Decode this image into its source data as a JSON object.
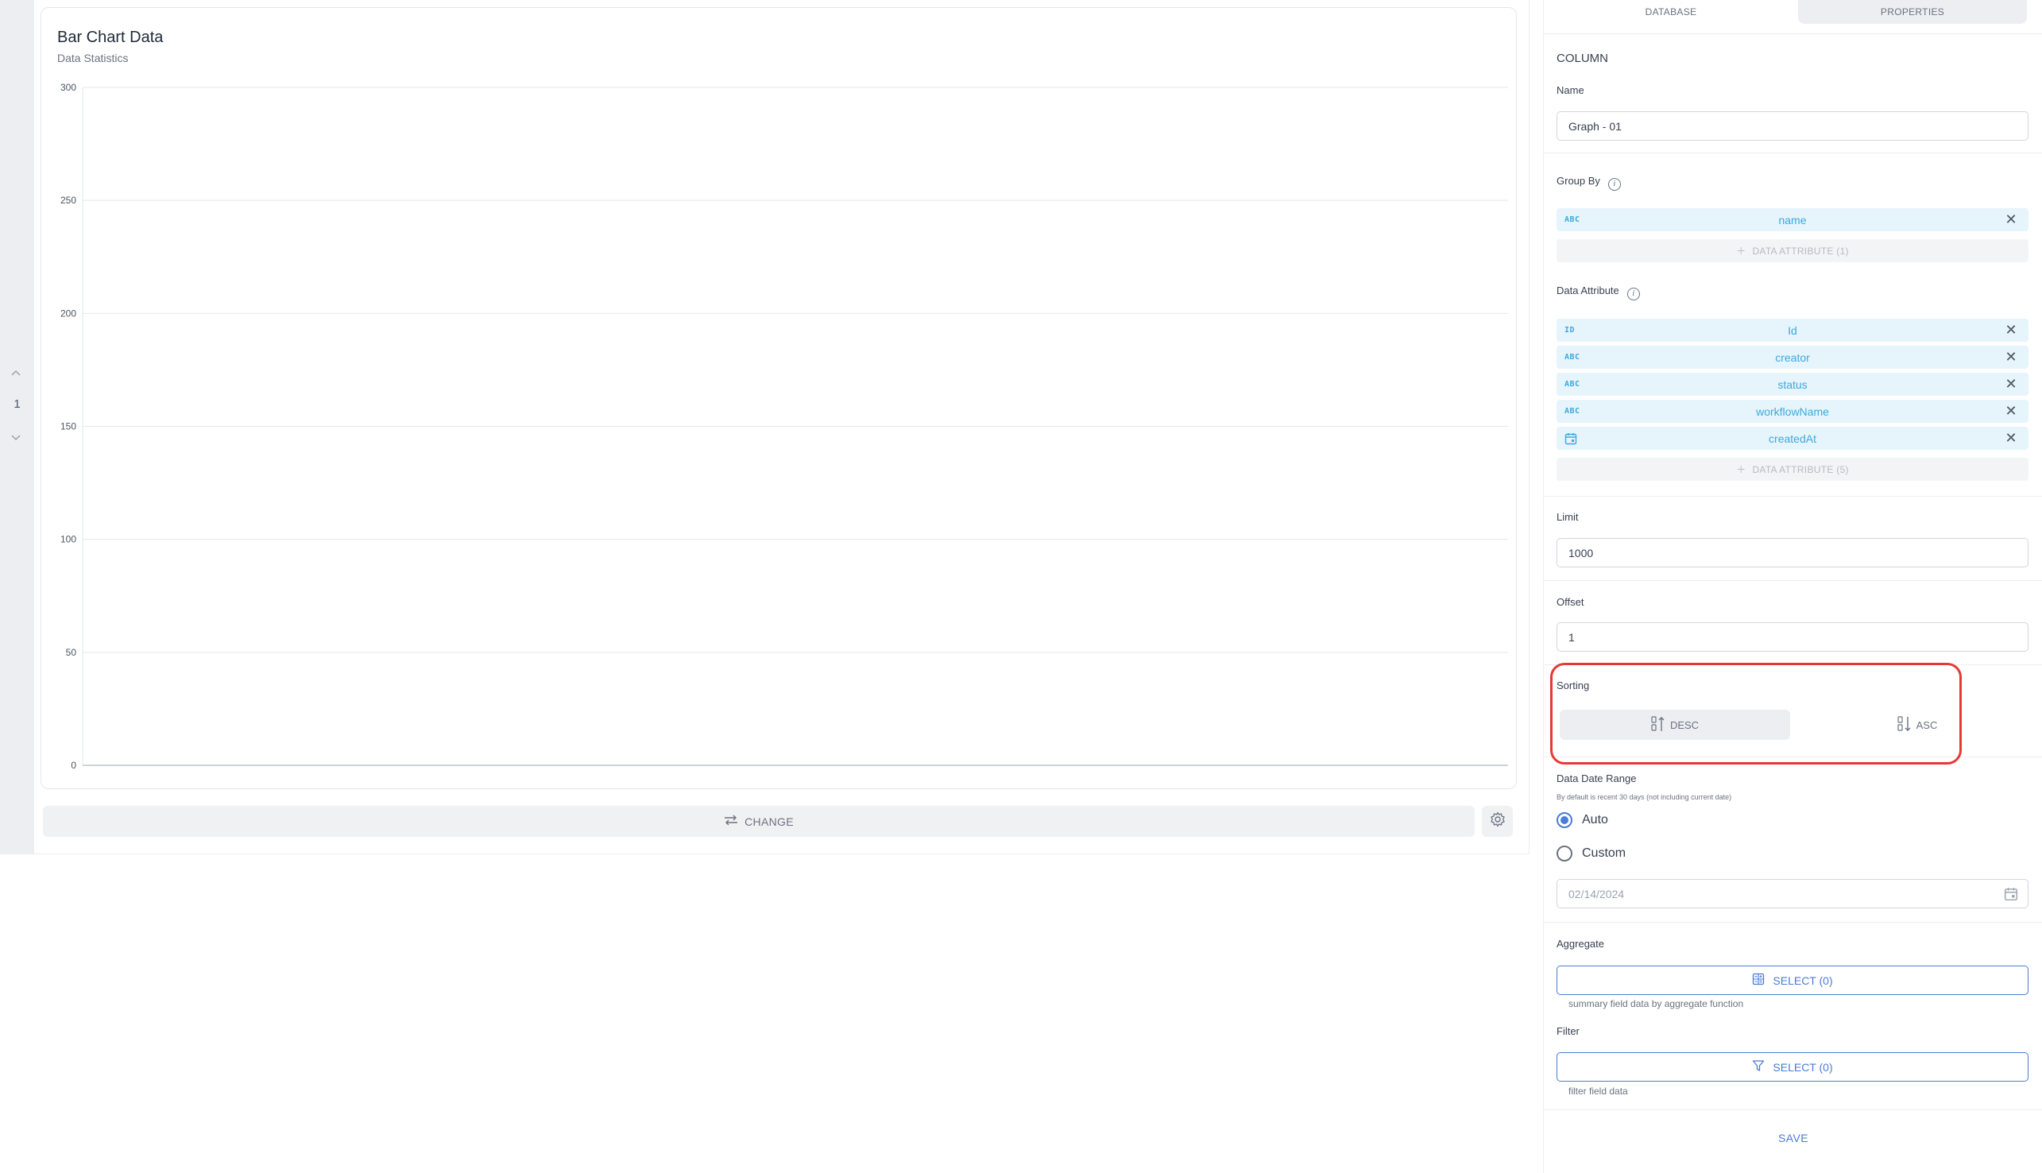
{
  "pager": {
    "page": "1"
  },
  "chart_card": {
    "title": "Bar Chart Data",
    "subtitle": "Data Statistics",
    "change_label": "CHANGE"
  },
  "chart_data": {
    "type": "bar",
    "title": "Bar Chart Data",
    "subtitle": "Data Statistics",
    "categories": [],
    "values": [],
    "ylim": [
      0,
      300
    ],
    "yticks": [
      "0",
      "50",
      "100",
      "150",
      "200",
      "250",
      "300"
    ],
    "grid": true
  },
  "panel": {
    "tabs": {
      "database": "DATABASE",
      "properties": "PROPERTIES"
    },
    "section_title": "COLUMN",
    "name_label": "Name",
    "name_value": "Graph - 01",
    "group_by_label": "Group By",
    "group_by": [
      {
        "type": "ABC",
        "name": "name"
      }
    ],
    "group_by_add": "DATA ATTRIBUTE (1)",
    "data_attr_label": "Data Attribute",
    "data_attrs": [
      {
        "type": "ID",
        "name": "Id"
      },
      {
        "type": "ABC",
        "name": "creator"
      },
      {
        "type": "ABC",
        "name": "status"
      },
      {
        "type": "ABC",
        "name": "workflowName"
      },
      {
        "type": "calendar-icon",
        "name": "createdAt"
      }
    ],
    "data_attr_add": "DATA ATTRIBUTE (5)",
    "limit_label": "Limit",
    "limit_value": "1000",
    "offset_label": "Offset",
    "offset_value": "1",
    "sorting_label": "Sorting",
    "sort_desc": "DESC",
    "sort_asc": "ASC",
    "date_range_label": "Data Date Range",
    "date_range_hint": "By default is recent 30 days (not including current date)",
    "radio_auto": "Auto",
    "radio_custom": "Custom",
    "date_placeholder": "02/14/2024",
    "aggregate_label": "Aggregate",
    "aggregate_btn": "SELECT (0)",
    "aggregate_hint": "summary field data by aggregate function",
    "filter_label": "Filter",
    "filter_btn": "SELECT (0)",
    "filter_hint": "filter field data",
    "save_label": "SAVE"
  },
  "colors": {
    "accent": "#4a7bd8",
    "chip_text": "#3aa9e0",
    "chip_bg": "#e6f4fb",
    "highlight": "#e53935"
  }
}
